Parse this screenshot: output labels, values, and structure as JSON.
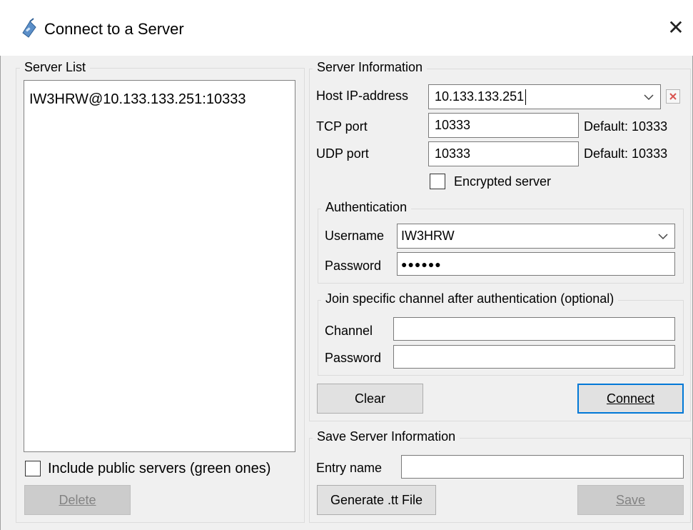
{
  "window": {
    "title": "Connect to a Server",
    "title_icon": "app-radio-icon",
    "close_icon": "close-icon",
    "close_glyph": "✕"
  },
  "server_list": {
    "group_label": "Server List",
    "items": [
      "IW3HRW@10.133.133.251:10333"
    ],
    "include_public_label": "Include public servers (green ones)",
    "include_public_checked": false,
    "delete_label": "Delete"
  },
  "server_info": {
    "group_label": "Server Information",
    "host_label": "Host IP-address",
    "host_value": "10.133.133.251",
    "tcp_label": "TCP port",
    "tcp_value": "10333",
    "tcp_default": "Default: 10333",
    "udp_label": "UDP port",
    "udp_value": "10333",
    "udp_default": "Default: 10333",
    "encrypted_label": "Encrypted server",
    "encrypted_checked": false
  },
  "auth": {
    "group_label": "Authentication",
    "username_label": "Username",
    "username_value": "IW3HRW",
    "password_label": "Password",
    "password_value": "●●●●●●"
  },
  "join": {
    "group_label": "Join specific channel after authentication (optional)",
    "channel_label": "Channel",
    "channel_value": "",
    "password_label": "Password",
    "password_value": ""
  },
  "actions": {
    "clear_label": "Clear",
    "connect_label": "Connect"
  },
  "save": {
    "group_label": "Save Server Information",
    "entry_label": "Entry name",
    "entry_value": "",
    "generate_label": "Generate .tt File",
    "save_label": "Save"
  },
  "colors": {
    "accent": "#0078d7",
    "clear_red": "#d9534f"
  }
}
